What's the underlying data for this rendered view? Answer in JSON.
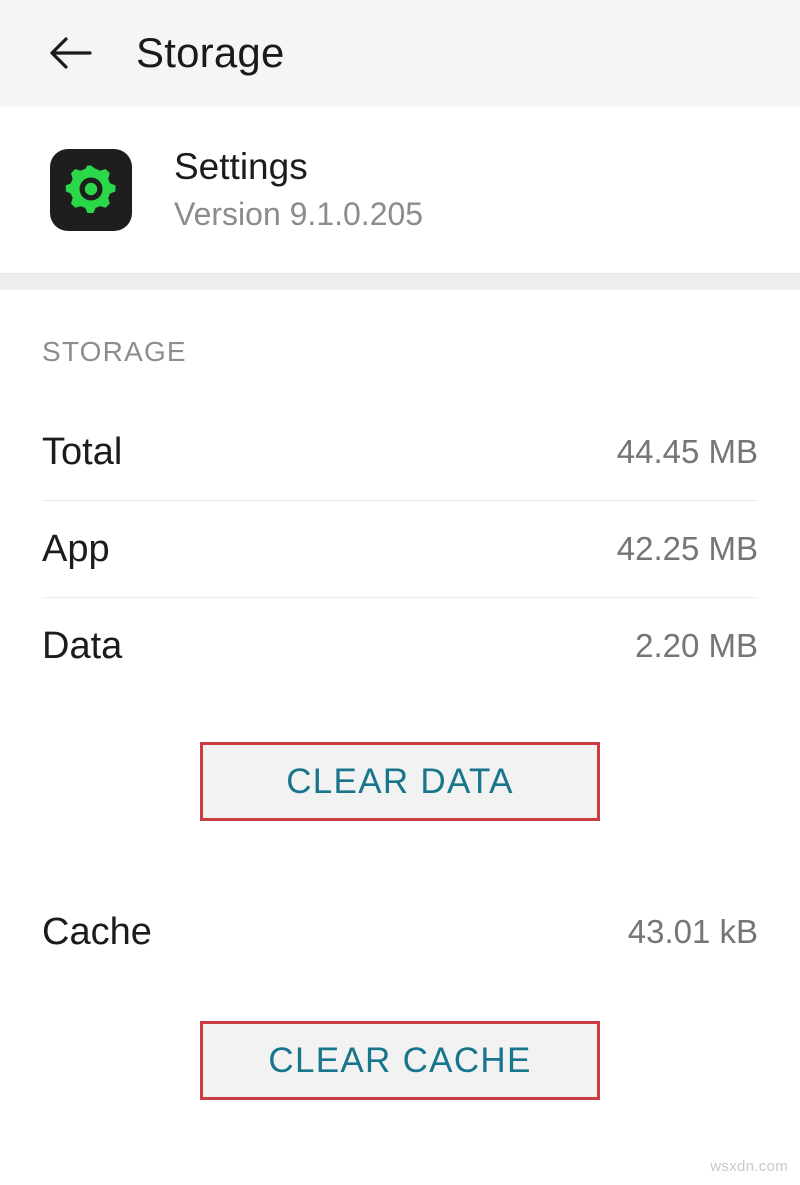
{
  "appbar": {
    "back_icon": "arrow-left-icon",
    "title": "Storage"
  },
  "app_info": {
    "icon": "settings-gear-icon",
    "icon_bg_color": "#1e1e1e",
    "icon_color": "#2bd84a",
    "name": "Settings",
    "version": "Version 9.1.0.205"
  },
  "storage_section": {
    "header": "STORAGE",
    "rows": [
      {
        "label": "Total",
        "value": "44.45 MB"
      },
      {
        "label": "App",
        "value": "42.25 MB"
      },
      {
        "label": "Data",
        "value": "2.20 MB"
      },
      {
        "label": "Cache",
        "value": "43.01 kB"
      }
    ],
    "clear_data_button": "CLEAR DATA",
    "clear_cache_button": "CLEAR CACHE"
  },
  "highlight": {
    "border_color": "#cc3b40",
    "button_text_color": "#17758c"
  },
  "watermark": "wsxdn.com"
}
